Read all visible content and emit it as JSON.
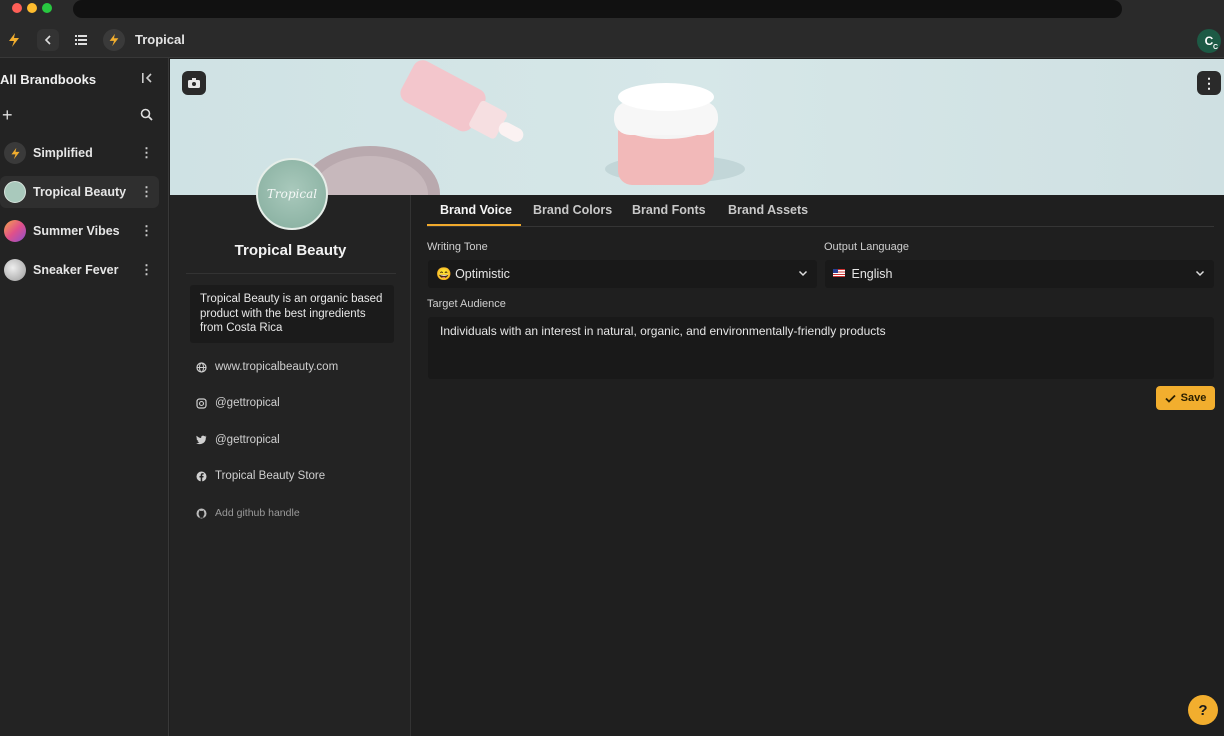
{
  "toolbar": {
    "title": "Tropical"
  },
  "user": {
    "initial": "C",
    "badge": "C"
  },
  "sidebar": {
    "heading": "All Brandbooks",
    "items": [
      {
        "label": "Simplified"
      },
      {
        "label": "Tropical Beauty"
      },
      {
        "label": "Summer Vibes"
      },
      {
        "label": "Sneaker Fever"
      }
    ]
  },
  "profile": {
    "logo_text": "Tropical",
    "name": "Tropical Beauty",
    "description": "Tropical Beauty is an organic based product with the best ingredients from Costa Rica",
    "links": {
      "website": "www.tropicalbeauty.com",
      "instagram": "@gettropical",
      "twitter": "@gettropical",
      "facebook": "Tropical Beauty Store",
      "github": "Add github handle"
    }
  },
  "tabs": [
    {
      "label": "Brand Voice"
    },
    {
      "label": "Brand Colors"
    },
    {
      "label": "Brand Fonts"
    },
    {
      "label": "Brand Assets"
    }
  ],
  "brand_voice": {
    "writing_tone_label": "Writing Tone",
    "writing_tone_value": "Optimistic",
    "output_language_label": "Output Language",
    "output_language_value": "English",
    "target_audience_label": "Target Audience",
    "target_audience_value": "Individuals with an interest in natural, organic, and environmentally-friendly products",
    "save_label": "Save"
  },
  "help": {
    "label": "?"
  },
  "colors": {
    "accent": "#f2ae2e",
    "background": "#1f1f1f",
    "sidebar": "#232323"
  }
}
